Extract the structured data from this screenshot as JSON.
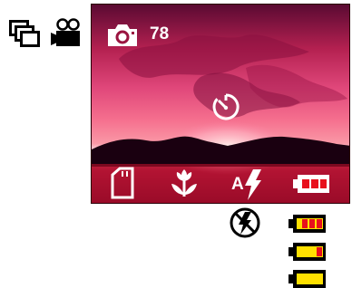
{
  "modes": {
    "multi_shot": "multi-window-icon",
    "video": "video-camera-icon"
  },
  "lcd": {
    "camera_mode_icon": "camera-icon",
    "shots_remaining": "78",
    "self_timer": "self-timer-icon",
    "status_bar": {
      "memory": "sd-card-icon",
      "macro": "macro-flower-icon",
      "flash_mode_label": "A",
      "flash_mode": "auto-flash-icon",
      "battery": "battery-low-icon"
    }
  },
  "legend": {
    "flash_off": "flash-off-icon",
    "battery_states": [
      {
        "name": "battery-low",
        "fill_fraction": 0.75,
        "fill_color": "#e8101c"
      },
      {
        "name": "battery-medium",
        "fill_fraction": 0.75,
        "fill_color": "#ffe000",
        "accent_color": "#e8101c"
      },
      {
        "name": "battery-full",
        "fill_fraction": 1.0,
        "fill_color": "#ffe000"
      }
    ]
  },
  "colors": {
    "red": "#e8101c",
    "yellow": "#ffe000",
    "white": "#ffffff",
    "black": "#000000"
  }
}
